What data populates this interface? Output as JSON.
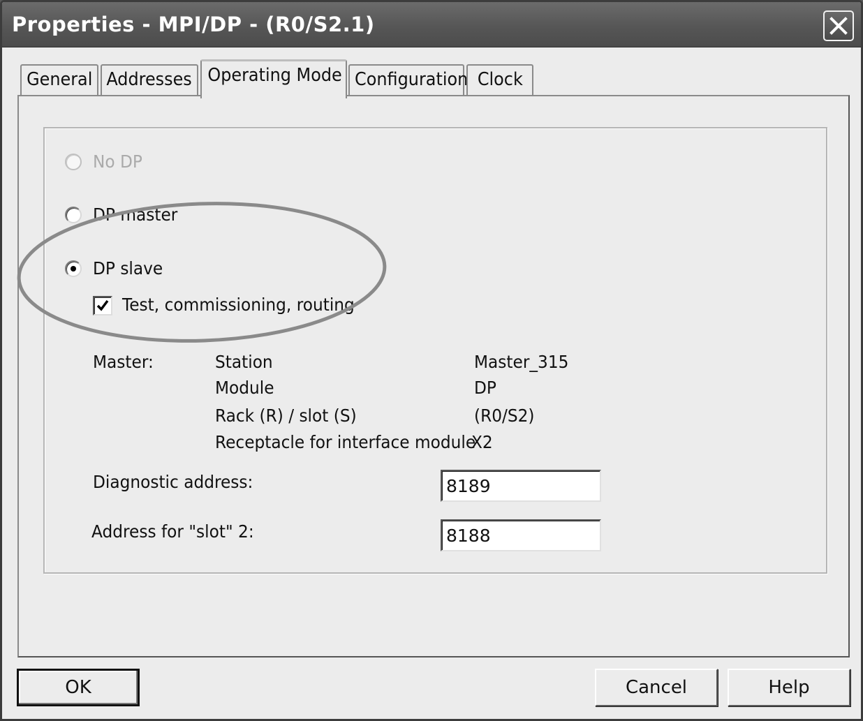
{
  "window": {
    "title": "Properties - MPI/DP - (R0/S2.1)"
  },
  "tabs": [
    {
      "label": "General"
    },
    {
      "label": "Addresses"
    },
    {
      "label": "Operating Mode"
    },
    {
      "label": "Configuration"
    },
    {
      "label": "Clock"
    }
  ],
  "mode": {
    "options": [
      {
        "label": "No DP",
        "enabled": false,
        "selected": false
      },
      {
        "label": "DP master",
        "enabled": true,
        "selected": false
      },
      {
        "label": "DP slave",
        "enabled": true,
        "selected": true
      }
    ],
    "test_routing": {
      "label": "Test, commissioning, routing",
      "checked": true
    }
  },
  "master": {
    "label": "Master:",
    "rows": [
      {
        "key": "Station",
        "value": "Master_315"
      },
      {
        "key": "Module",
        "value": "DP"
      },
      {
        "key": "Rack (R) / slot (S)",
        "value": "(R0/S2)"
      },
      {
        "key": "Receptacle for interface module",
        "value": "X2"
      }
    ]
  },
  "diagnostic": {
    "label": "Diagnostic address:",
    "value": "8189"
  },
  "slot_address": {
    "label": "Address for \"slot\" 2:",
    "value": "8188"
  },
  "buttons": {
    "ok": "OK",
    "cancel": "Cancel",
    "help": "Help"
  },
  "colors": {
    "title_bar": "#565656",
    "dialog_bg": "#ececec",
    "highlight": "#8a8a8a"
  }
}
